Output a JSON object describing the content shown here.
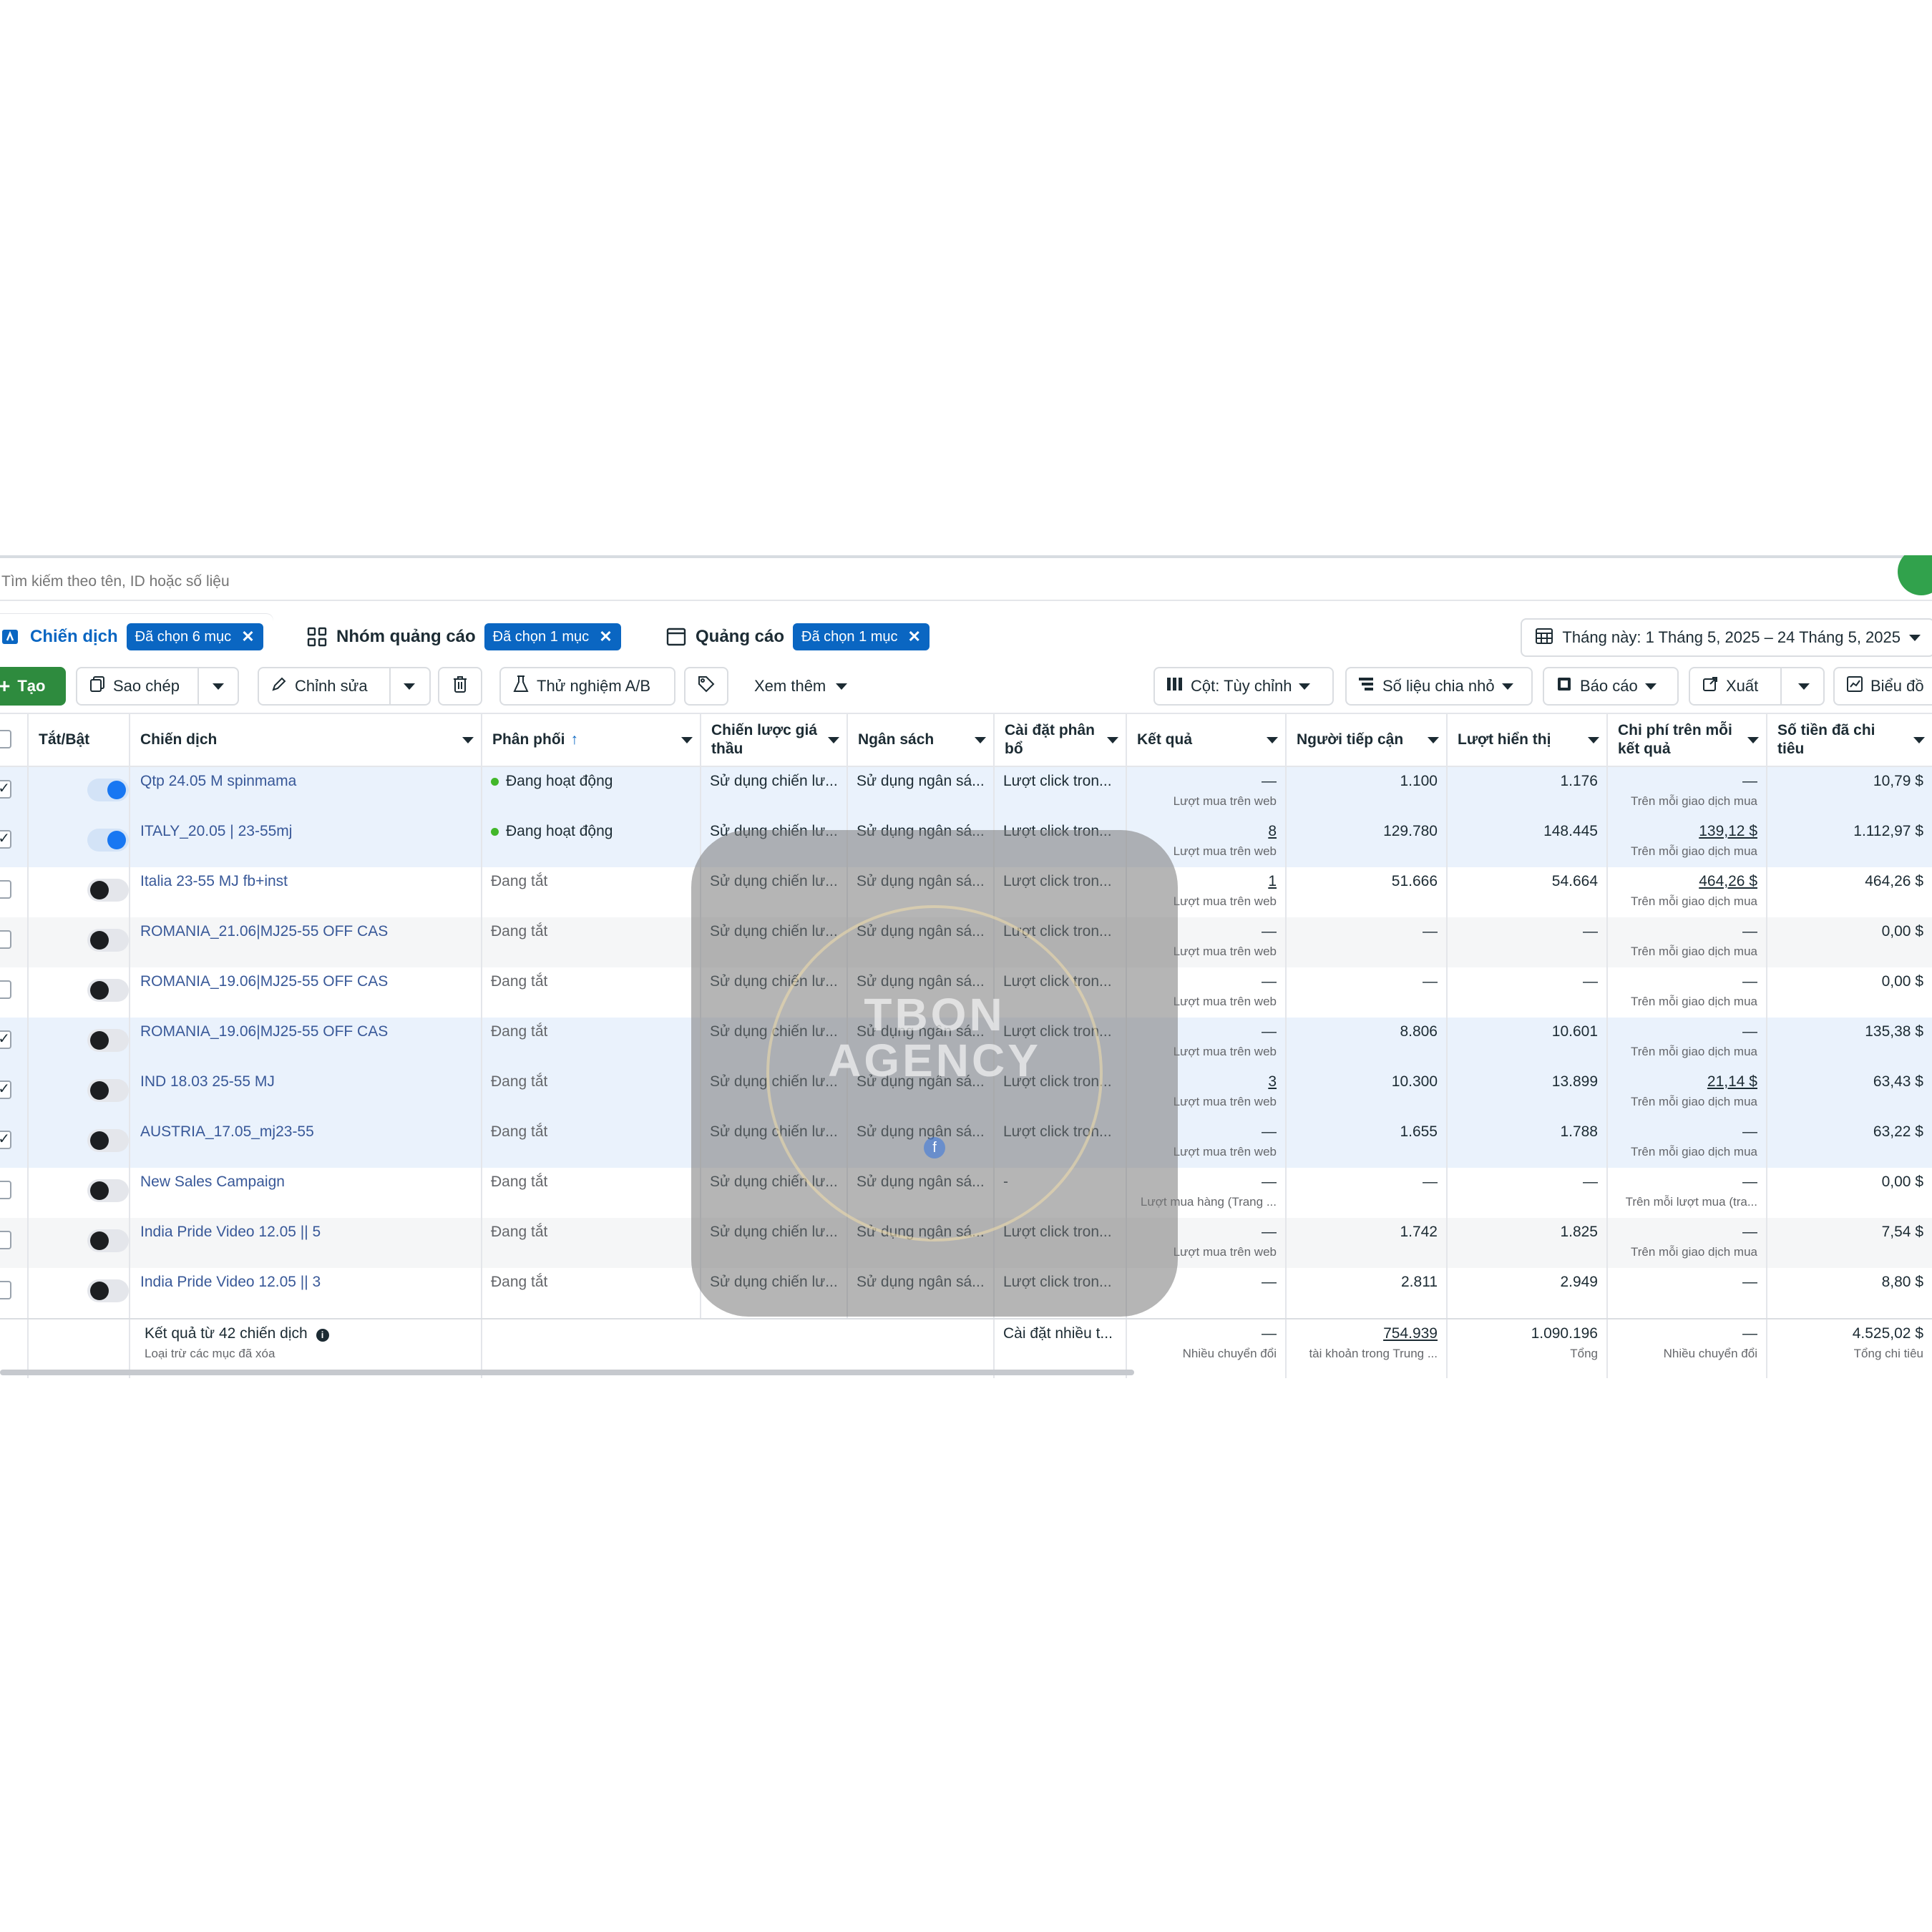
{
  "search": {
    "placeholder": "Tìm kiếm theo tên, ID hoặc số liệu"
  },
  "level_tabs": [
    {
      "label": "Chiến dịch",
      "chip": "Đã chọn 6 mục",
      "icon": "campaign-icon"
    },
    {
      "label": "Nhóm quảng cáo",
      "chip": "Đã chọn 1 mục",
      "icon": "grid-icon"
    },
    {
      "label": "Quảng cáo",
      "chip": "Đã chọn 1 mục",
      "icon": "ad-icon"
    }
  ],
  "date_range": "Tháng này: 1 Tháng 5, 2025 – 24 Tháng 5, 2025",
  "toolbar": {
    "create": "Tạo",
    "duplicate": "Sao chép",
    "edit": "Chỉnh sửa",
    "ab_test": "Thử nghiệm A/B",
    "more": "Xem thêm",
    "columns": "Cột: Tùy chỉnh",
    "breakdown": "Số liệu chia nhỏ",
    "reports": "Báo cáo",
    "export": "Xuất",
    "charts": "Biểu đồ"
  },
  "columns": {
    "toggle": "Tắt/Bật",
    "campaign": "Chiến dịch",
    "delivery": "Phân phối",
    "bid_strategy": "Chiến lược giá thầu",
    "budget": "Ngân sách",
    "attribution": "Cài đặt phân bổ",
    "results": "Kết quả",
    "reach": "Người tiếp cận",
    "impressions": "Lượt hiển thị",
    "cost_per_result": "Chi phí trên mỗi kết quả",
    "amount_spent": "Số tiền đã chi tiêu"
  },
  "rows": [
    {
      "on": true,
      "checked": true,
      "name": "Qtp 24.05 M spinmama",
      "delivery": "Đang hoạt động",
      "active": true,
      "bid": "Sử dụng chiến lư...",
      "budget": "Sử dụng ngân sá...",
      "attribution": "Lượt click tron...",
      "results": "—",
      "results_sub": "Lượt mua trên web",
      "reach": "1.100",
      "impressions": "1.176",
      "cpr": "—",
      "cpr_sub": "Trên mỗi giao dịch mua",
      "spent": "10,79 $"
    },
    {
      "on": true,
      "checked": true,
      "name": "ITALY_20.05 | 23-55mj",
      "delivery": "Đang hoạt động",
      "active": true,
      "bid": "Sử dụng chiến lư...",
      "budget": "Sử dụng ngân sá...",
      "attribution": "Lượt click tron...",
      "results": "8",
      "results_sub": "Lượt mua trên web",
      "reach": "129.780",
      "impressions": "148.445",
      "cpr": "139,12 $",
      "cpr_sub": "Trên mỗi giao dịch mua",
      "spent": "1.112,97 $"
    },
    {
      "on": false,
      "checked": false,
      "name": "Italia 23-55 MJ fb+inst",
      "delivery": "Đang tắt",
      "active": false,
      "bid": "Sử dụng chiến lư...",
      "budget": "Sử dụng ngân sá...",
      "attribution": "Lượt click tron...",
      "results": "1",
      "results_sub": "Lượt mua trên web",
      "reach": "51.666",
      "impressions": "54.664",
      "cpr": "464,26 $",
      "cpr_sub": "Trên mỗi giao dịch mua",
      "spent": "464,26 $"
    },
    {
      "on": false,
      "checked": false,
      "name": "ROMANIA_21.06|MJ25-55 OFF CAS",
      "delivery": "Đang tắt",
      "active": false,
      "bid": "Sử dụng chiến lư...",
      "budget": "Sử dụng ngân sá...",
      "attribution": "Lượt click tron...",
      "results": "—",
      "results_sub": "Lượt mua trên web",
      "reach": "—",
      "impressions": "—",
      "cpr": "—",
      "cpr_sub": "Trên mỗi giao dịch mua",
      "spent": "0,00 $"
    },
    {
      "on": false,
      "checked": false,
      "name": "ROMANIA_19.06|MJ25-55 OFF CAS",
      "delivery": "Đang tắt",
      "active": false,
      "bid": "Sử dụng chiến lư...",
      "budget": "Sử dụng ngân sá...",
      "attribution": "Lượt click tron...",
      "results": "—",
      "results_sub": "Lượt mua trên web",
      "reach": "—",
      "impressions": "—",
      "cpr": "—",
      "cpr_sub": "Trên mỗi giao dịch mua",
      "spent": "0,00 $"
    },
    {
      "on": false,
      "checked": true,
      "name": "ROMANIA_19.06|MJ25-55 OFF CAS",
      "delivery": "Đang tắt",
      "active": false,
      "bid": "Sử dụng chiến lư...",
      "budget": "Sử dụng ngân sá...",
      "attribution": "Lượt click tron...",
      "results": "—",
      "results_sub": "Lượt mua trên web",
      "reach": "8.806",
      "impressions": "10.601",
      "cpr": "—",
      "cpr_sub": "Trên mỗi giao dịch mua",
      "spent": "135,38 $"
    },
    {
      "on": false,
      "checked": true,
      "name": "IND 18.03 25-55 MJ",
      "delivery": "Đang tắt",
      "active": false,
      "bid": "Sử dụng chiến lư...",
      "budget": "Sử dụng ngân sá...",
      "attribution": "Lượt click tron...",
      "results": "3",
      "results_sub": "Lượt mua trên web",
      "reach": "10.300",
      "impressions": "13.899",
      "cpr": "21,14 $",
      "cpr_sub": "Trên mỗi giao dịch mua",
      "spent": "63,43 $"
    },
    {
      "on": false,
      "checked": true,
      "name": "AUSTRIA_17.05_mj23-55",
      "delivery": "Đang tắt",
      "active": false,
      "bid": "Sử dụng chiến lư...",
      "budget": "Sử dụng ngân sá...",
      "attribution": "Lượt click tron...",
      "results": "—",
      "results_sub": "Lượt mua trên web",
      "reach": "1.655",
      "impressions": "1.788",
      "cpr": "—",
      "cpr_sub": "Trên mỗi giao dịch mua",
      "spent": "63,22 $"
    },
    {
      "on": false,
      "checked": false,
      "name": "New Sales Campaign",
      "delivery": "Đang tắt",
      "active": false,
      "bid": "Sử dụng chiến lư...",
      "budget": "Sử dụng ngân sá...",
      "attribution": "-",
      "results": "—",
      "results_sub": "Lượt mua hàng (Trang ...",
      "reach": "—",
      "impressions": "—",
      "cpr": "—",
      "cpr_sub": "Trên mỗi lượt mua (tra...",
      "spent": "0,00 $"
    },
    {
      "on": false,
      "checked": false,
      "name": "India Pride Video 12.05 || 5",
      "delivery": "Đang tắt",
      "active": false,
      "bid": "Sử dụng chiến lư...",
      "budget": "Sử dụng ngân sá...",
      "attribution": "Lượt click tron...",
      "results": "—",
      "results_sub": "Lượt mua trên web",
      "reach": "1.742",
      "impressions": "1.825",
      "cpr": "—",
      "cpr_sub": "Trên mỗi giao dịch mua",
      "spent": "7,54 $"
    },
    {
      "on": false,
      "checked": false,
      "name": "India Pride Video 12.05 || 3",
      "delivery": "Đang tắt",
      "active": false,
      "bid": "Sử dụng chiến lư...",
      "budget": "Sử dụng ngân sá...",
      "attribution": "Lượt click tron...",
      "results": "—",
      "results_sub": "",
      "reach": "2.811",
      "impressions": "2.949",
      "cpr": "—",
      "cpr_sub": "",
      "spent": "8,80 $"
    }
  ],
  "footer": {
    "summary": "Kết quả từ 42 chiến dịch",
    "summary_sub": "Loại trừ các mục đã xóa",
    "attribution": "Cài đặt nhiều t...",
    "results": "—",
    "results_sub": "Nhiều chuyển đổi",
    "reach": "754.939",
    "reach_sub": "tài khoản trong Trung ...",
    "impressions": "1.090.196",
    "impressions_sub": "Tổng",
    "cpr": "—",
    "cpr_sub": "Nhiều chuyển đổi",
    "spent": "4.525,02 $",
    "spent_sub": "Tổng chi tiêu"
  },
  "watermark": {
    "line1": "TBON",
    "line2": "AGENCY"
  },
  "colors": {
    "accent": "#0a66c2",
    "create_button": "#2e8b3e",
    "active_dot": "#42b72a",
    "selected_row": "#eaf2fc"
  }
}
